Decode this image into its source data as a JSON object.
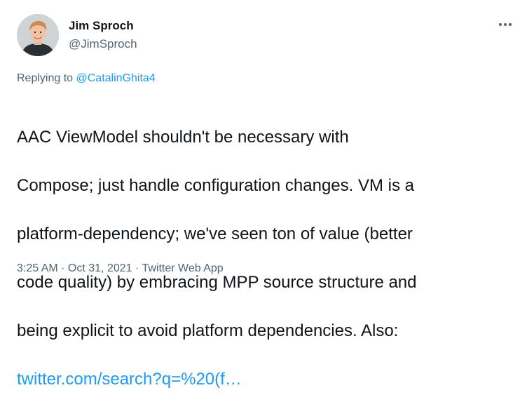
{
  "author": {
    "display_name": "Jim Sproch",
    "handle": "@JimSproch"
  },
  "reply": {
    "prefix": "Replying to ",
    "to_handle": "@CatalinGhita4"
  },
  "tweet": {
    "line_1": "AAC ViewModel shouldn't be necessary with",
    "line_2": "Compose; just handle configuration changes. VM is a",
    "line_3": "platform-dependency; we've seen ton of value (better",
    "line_4": "code quality) by embracing MPP source structure and",
    "line_5": "being explicit to avoid platform dependencies. Also:",
    "link": "twitter.com/search?q=%20(f…"
  },
  "meta": {
    "time": "3:25 AM",
    "separator": " · ",
    "date": "Oct 31, 2021",
    "source": "Twitter Web App"
  },
  "icons": {
    "more": "more-dots-icon"
  },
  "colors": {
    "link": "#1d9bf0",
    "secondary_text": "#536471",
    "primary_text": "#0f1419"
  }
}
